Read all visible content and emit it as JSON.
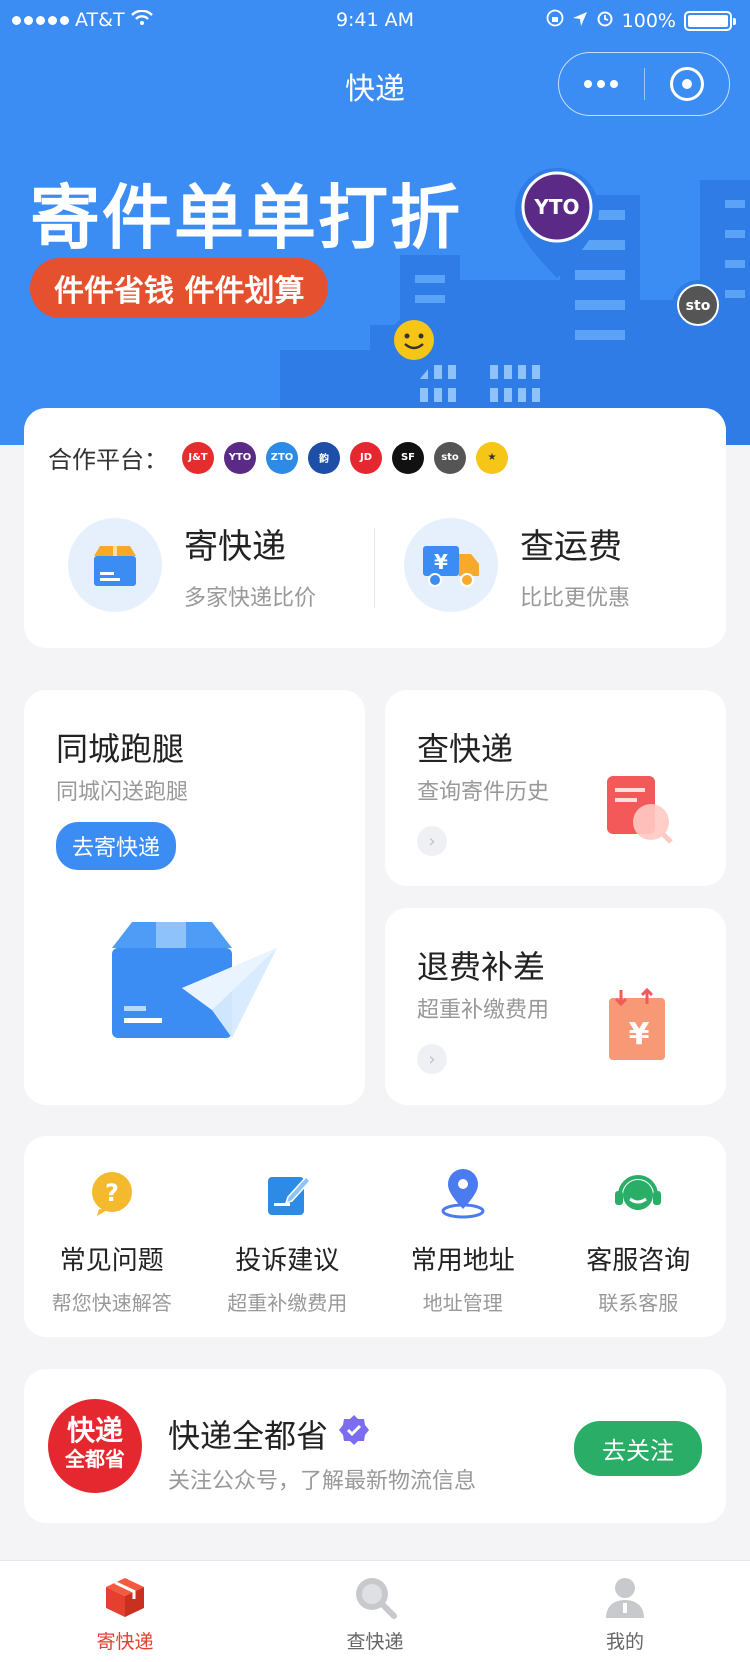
{
  "status_bar": {
    "carrier": "AT&T",
    "time": "9:41 AM",
    "battery": "100%"
  },
  "nav": {
    "title": "快递"
  },
  "hero": {
    "title": "寄件单单打折",
    "pill": "件件省钱 件件划算"
  },
  "partners": {
    "label": "合作平台：",
    "logos": [
      {
        "name": "J&T",
        "text": "J&T",
        "color": "#e52d2d"
      },
      {
        "name": "YTO",
        "text": "YTO",
        "color": "#5b2a86"
      },
      {
        "name": "ZTO",
        "text": "ZTO",
        "color": "#2d8be5"
      },
      {
        "name": "Yunda",
        "text": "韵",
        "color": "#1d4ea8"
      },
      {
        "name": "JD",
        "text": "JD",
        "color": "#e5282f"
      },
      {
        "name": "SF",
        "text": "SF",
        "color": "#111111"
      },
      {
        "name": "STO",
        "text": "sto",
        "color": "#555555"
      },
      {
        "name": "Best",
        "text": "★",
        "color": "#f5c518"
      }
    ]
  },
  "actions": {
    "send": {
      "title": "寄快递",
      "sub": "多家快递比价"
    },
    "fee": {
      "title": "查运费",
      "sub": "比比更优惠"
    }
  },
  "cards": {
    "errand": {
      "title": "同城跑腿",
      "sub": "同城闪送跑腿",
      "button": "去寄快递"
    },
    "track": {
      "title": "查快递",
      "sub": "查询寄件历史"
    },
    "refund": {
      "title": "退费补差",
      "sub": "超重补缴费用"
    }
  },
  "services": [
    {
      "title": "常见问题",
      "sub": "帮您快速解答",
      "icon": "question-icon",
      "color": "#f5b92e"
    },
    {
      "title": "投诉建议",
      "sub": "超重补缴费用",
      "icon": "edit-icon",
      "color": "#2d8be5"
    },
    {
      "title": "常用地址",
      "sub": "地址管理",
      "icon": "location-icon",
      "color": "#4a7cf0"
    },
    {
      "title": "客服咨询",
      "sub": "联系客服",
      "icon": "headset-icon",
      "color": "#2aae67"
    }
  ],
  "follow": {
    "avatar_line1": "快递",
    "avatar_line2": "全都省",
    "name": "快递全都省",
    "desc": "关注公众号，了解最新物流信息",
    "button": "去关注"
  },
  "tabbar": [
    {
      "label": "寄快递",
      "icon": "box-icon",
      "active": true
    },
    {
      "label": "查快递",
      "icon": "search-icon",
      "active": false
    },
    {
      "label": "我的",
      "icon": "user-icon",
      "active": false
    }
  ],
  "colors": {
    "brand_blue": "#3b8cf3",
    "accent_red": "#e5402f",
    "green": "#2aae67"
  }
}
